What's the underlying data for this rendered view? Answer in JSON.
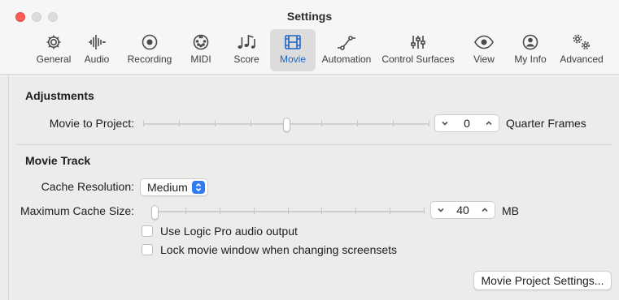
{
  "window": {
    "title": "Settings"
  },
  "colors": {
    "accent": "#1f63c6",
    "close": "#ff5f57",
    "popup_arrow": "#2f7bf6"
  },
  "tabs": [
    {
      "label": "General",
      "icon": "gear-icon",
      "active": false
    },
    {
      "label": "Audio",
      "icon": "waveform-icon",
      "active": false
    },
    {
      "label": "Recording",
      "icon": "record-icon",
      "active": false
    },
    {
      "label": "MIDI",
      "icon": "midi-connector-icon",
      "active": false
    },
    {
      "label": "Score",
      "icon": "music-notes-icon",
      "active": false
    },
    {
      "label": "Movie",
      "icon": "film-icon",
      "active": true
    },
    {
      "label": "Automation",
      "icon": "automation-curve-icon",
      "active": false
    },
    {
      "label": "Control Surfaces",
      "icon": "faders-icon",
      "active": false
    },
    {
      "label": "View",
      "icon": "eye-icon",
      "active": false
    },
    {
      "label": "My Info",
      "icon": "person-icon",
      "active": false
    },
    {
      "label": "Advanced",
      "icon": "gears-icon",
      "active": false
    }
  ],
  "adjustments": {
    "title": "Adjustments",
    "movie_to_project": {
      "label": "Movie to Project:",
      "value": "0",
      "unit": "Quarter Frames",
      "slider_fraction": 0.5
    }
  },
  "movie_track": {
    "title": "Movie Track",
    "cache_resolution": {
      "label": "Cache Resolution:",
      "value": "Medium"
    },
    "max_cache_size": {
      "label": "Maximum Cache Size:",
      "value": "40",
      "unit": "MB",
      "slider_fraction": 0.0
    },
    "use_logic_audio": {
      "label": "Use Logic Pro audio output",
      "checked": false
    },
    "lock_movie_window": {
      "label": "Lock movie window when changing screensets",
      "checked": false
    },
    "project_settings_button": "Movie Project Settings..."
  }
}
